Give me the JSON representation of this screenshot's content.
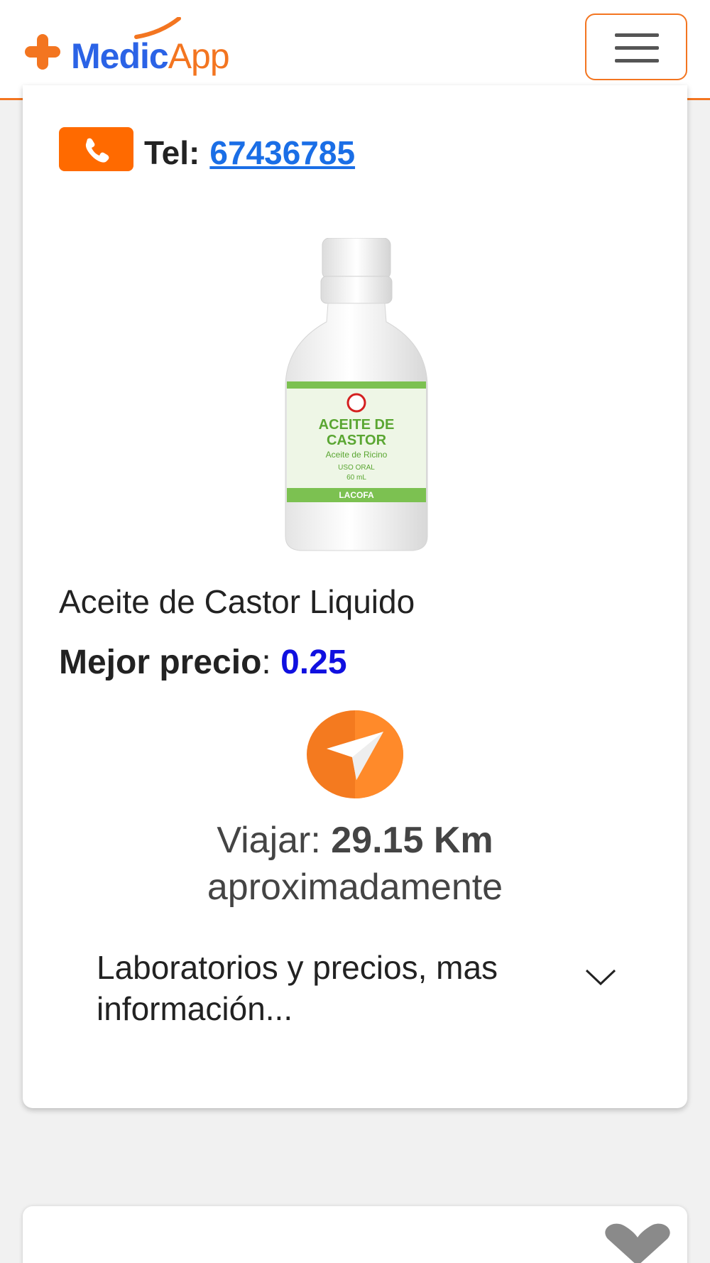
{
  "header": {
    "logo_medic": "Medic",
    "logo_app": "App",
    "menu_icon": "hamburger-icon",
    "accent_color": "#f37520"
  },
  "card": {
    "phone_icon": "phone-icon",
    "phone_label": "Tel:",
    "phone_number": "67436785",
    "product_image_icon": "castor-oil-bottle",
    "bottle_label": {
      "title_line1": "ACEITE DE",
      "title_line2": "CASTOR",
      "subtitle": "Aceite de Ricino",
      "use": "USO ORAL",
      "volume": "60 mL",
      "brand": "LACOFA"
    },
    "product_name": "Aceite de Castor Liquido",
    "price_label": "Mejor precio",
    "price_separator": ":",
    "price_value": "0.25",
    "navigate_icon": "navigation-arrow-icon",
    "travel_label": "Viajar:",
    "travel_distance": "29.15 Km",
    "travel_suffix": "aproximadamente",
    "accordion_label": "Laboratorios y precios, mas información...",
    "accordion_icon": "chevron-down-icon"
  },
  "card2": {
    "favorite_icon": "heart-icon"
  }
}
